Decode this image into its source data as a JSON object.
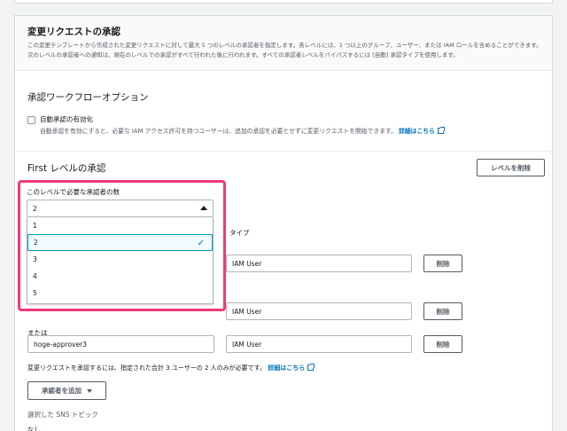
{
  "section": {
    "title": "変更リクエストの承認",
    "description": "この変更テンプレートから作成された変更リクエストに対して最大 5 つのレベルの承認者を指定します。各レベルには、1 つ以上のグループ、ユーザー、または IAM ロールを含めることができます。次のレベルの承認者への通知は、現在のレベルでの承認がすべて行われた後に行われます。すべての承認者レベルをバイパスするには [自動] 承認タイプを使用します。"
  },
  "workflow_options": {
    "heading": "承認ワークフローオプション",
    "auto_approve_label": "自動承認の有効化",
    "auto_approve_checked": false,
    "auto_approve_help": "自動承認を有効にすると、必要な IAM アクセス許可を持つユーザーは、追加の承認を必要とせずに変更リクエストを開始できます。",
    "details_link": "詳細はこちら"
  },
  "level": {
    "heading": "First レベルの承認",
    "delete_level_button": "レベルを削除",
    "required_count_label": "このレベルで必要な承認者の数",
    "required_count_value": "2",
    "options": [
      "1",
      "2",
      "3",
      "4",
      "5"
    ],
    "selected_option": "2"
  },
  "approvers": {
    "type_header_partial": "タイプ",
    "or_label": "または",
    "rows": [
      {
        "name": "",
        "type": "IAM User",
        "delete_label": "削除"
      },
      {
        "name": "",
        "type": "IAM User",
        "delete_label": "削除"
      },
      {
        "name": "hoge-approver3",
        "type": "IAM User",
        "delete_label": "削除"
      }
    ],
    "summary_text": "変更リクエストを承認するには、指定された合計 3 ユーザーの 2 人のみが必要です。",
    "summary_link": "詳細はこちら",
    "add_approver_button": "承認者を追加"
  },
  "sns": {
    "label": "選択した SNS トピック",
    "value": "なし"
  },
  "colors": {
    "accent": "#0073bb",
    "highlight": "#f0397b",
    "selected_bg": "#f1faff",
    "selected_border": "#00a1c9"
  }
}
